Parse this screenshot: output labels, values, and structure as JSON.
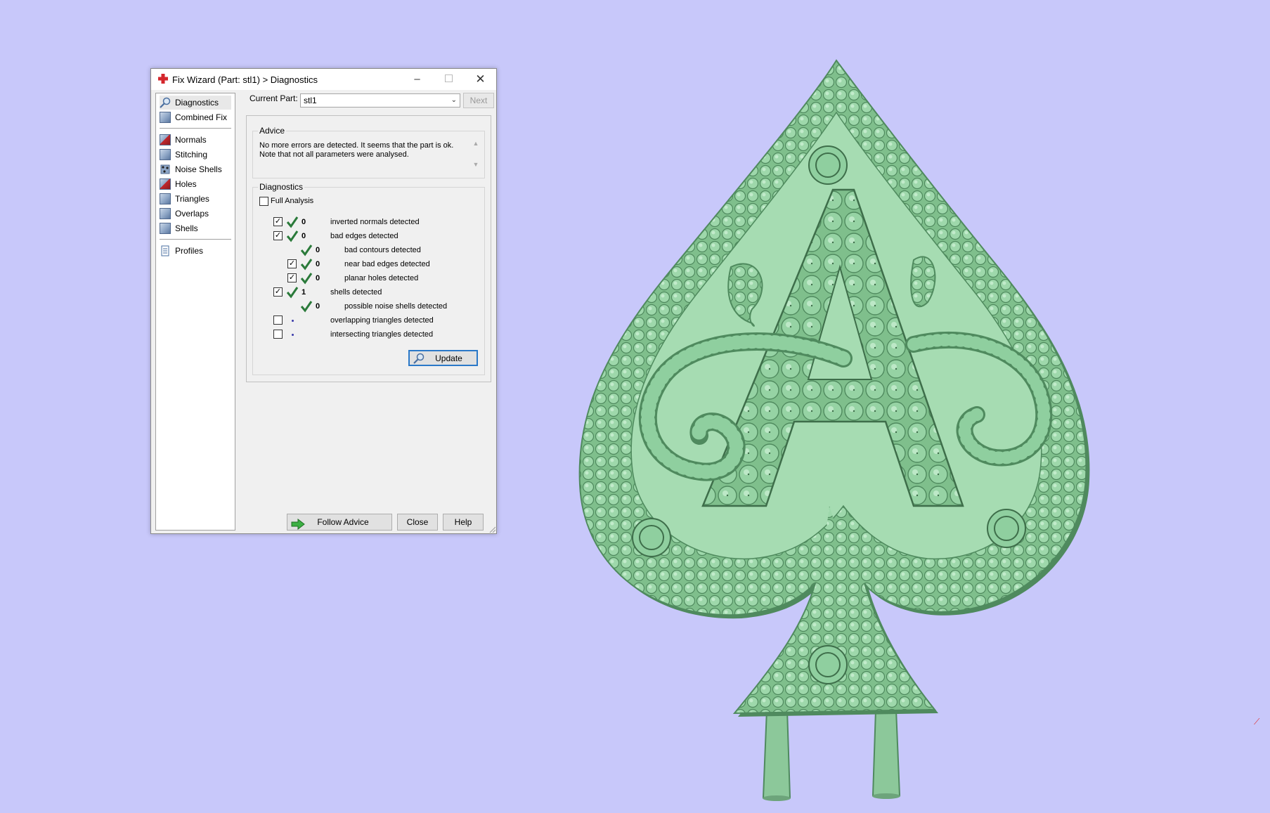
{
  "window": {
    "title": "Fix Wizard (Part: stl1) > Diagnostics",
    "minimize": "–",
    "maximize": "☐",
    "close": "✕"
  },
  "sidebar": {
    "items": [
      {
        "label": "Diagnostics",
        "icon": "magnifier-icon"
      },
      {
        "label": "Combined Fix",
        "icon": "cube-icon"
      },
      {
        "label": "Normals",
        "icon": "normals-cube-icon"
      },
      {
        "label": "Stitching",
        "icon": "cube-icon"
      },
      {
        "label": "Noise Shells",
        "icon": "noise-shells-icon"
      },
      {
        "label": "Holes",
        "icon": "holes-cube-icon"
      },
      {
        "label": "Triangles",
        "icon": "triangles-cube-icon"
      },
      {
        "label": "Overlaps",
        "icon": "cube-icon"
      },
      {
        "label": "Shells",
        "icon": "cube-icon"
      },
      {
        "label": "Profiles",
        "icon": "document-icon"
      }
    ]
  },
  "current_part": {
    "label": "Current Part:",
    "value": "stl1",
    "next": "Next"
  },
  "advice": {
    "label": "Advice",
    "line1": "No more errors are detected. It seems that the part is ok.",
    "line2": "Note that not all parameters were analysed."
  },
  "diagnostics": {
    "label": "Diagnostics",
    "full_analysis": "Full Analysis",
    "rows": [
      {
        "count": "0",
        "text": "inverted normals detected"
      },
      {
        "count": "0",
        "text": "bad edges detected"
      },
      {
        "count": "0",
        "text": "bad contours detected"
      },
      {
        "count": "0",
        "text": "near bad edges detected"
      },
      {
        "count": "0",
        "text": "planar holes detected"
      },
      {
        "count": "1",
        "text": "shells detected"
      },
      {
        "count": "0",
        "text": "possible noise shells detected"
      },
      {
        "count": "",
        "text": "overlapping triangles detected"
      },
      {
        "count": "",
        "text": "intersecting triangles detected"
      }
    ],
    "update": "Update"
  },
  "footer": {
    "follow_advice": "Follow Advice",
    "close": "Close",
    "help": "Help"
  },
  "colors": {
    "background": "#c8c8fa",
    "model": "#8fcf9f",
    "check": "#2a7a3a"
  }
}
